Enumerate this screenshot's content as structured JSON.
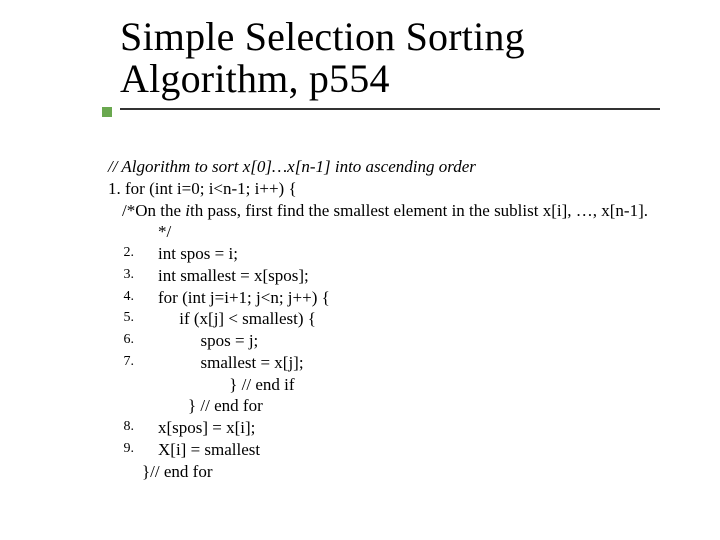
{
  "title": {
    "line1": "Simple Selection Sorting",
    "line2": "Algorithm, p554"
  },
  "body": {
    "comment_algo_pre": "// Algorithm to sort ",
    "comment_algo_range": "x[0]…x[n-1]",
    "comment_algo_post": " into ascending order",
    "line1": "1. for (int i=0; i<n-1; i++) {",
    "comment_pass_pre": "/*On the ",
    "comment_pass_i": "i",
    "comment_pass_post": "th pass, first find the smallest element in the sublist x[i], …, x[n-1].",
    "comment_close": "*/",
    "l2": "int spos = i;",
    "l3": "int smallest = x[spos];",
    "l4": "for (int j=i+1; j<n; j++) {",
    "l5": "     if (x[j] < smallest) {",
    "l6": "          spos = j;",
    "l7": "          smallest = x[j];",
    "l7_end1": "     } // end if",
    "l7_end2": "} // end for",
    "l8": "x[spos] = x[i];",
    "l9": "X[i] = smallest",
    "end_for": "}// end for",
    "n2": "2.",
    "n3": "3.",
    "n4": "4.",
    "n5": "5.",
    "n6": "6.",
    "n7": "7.",
    "n8": "8.",
    "n9": "9."
  }
}
